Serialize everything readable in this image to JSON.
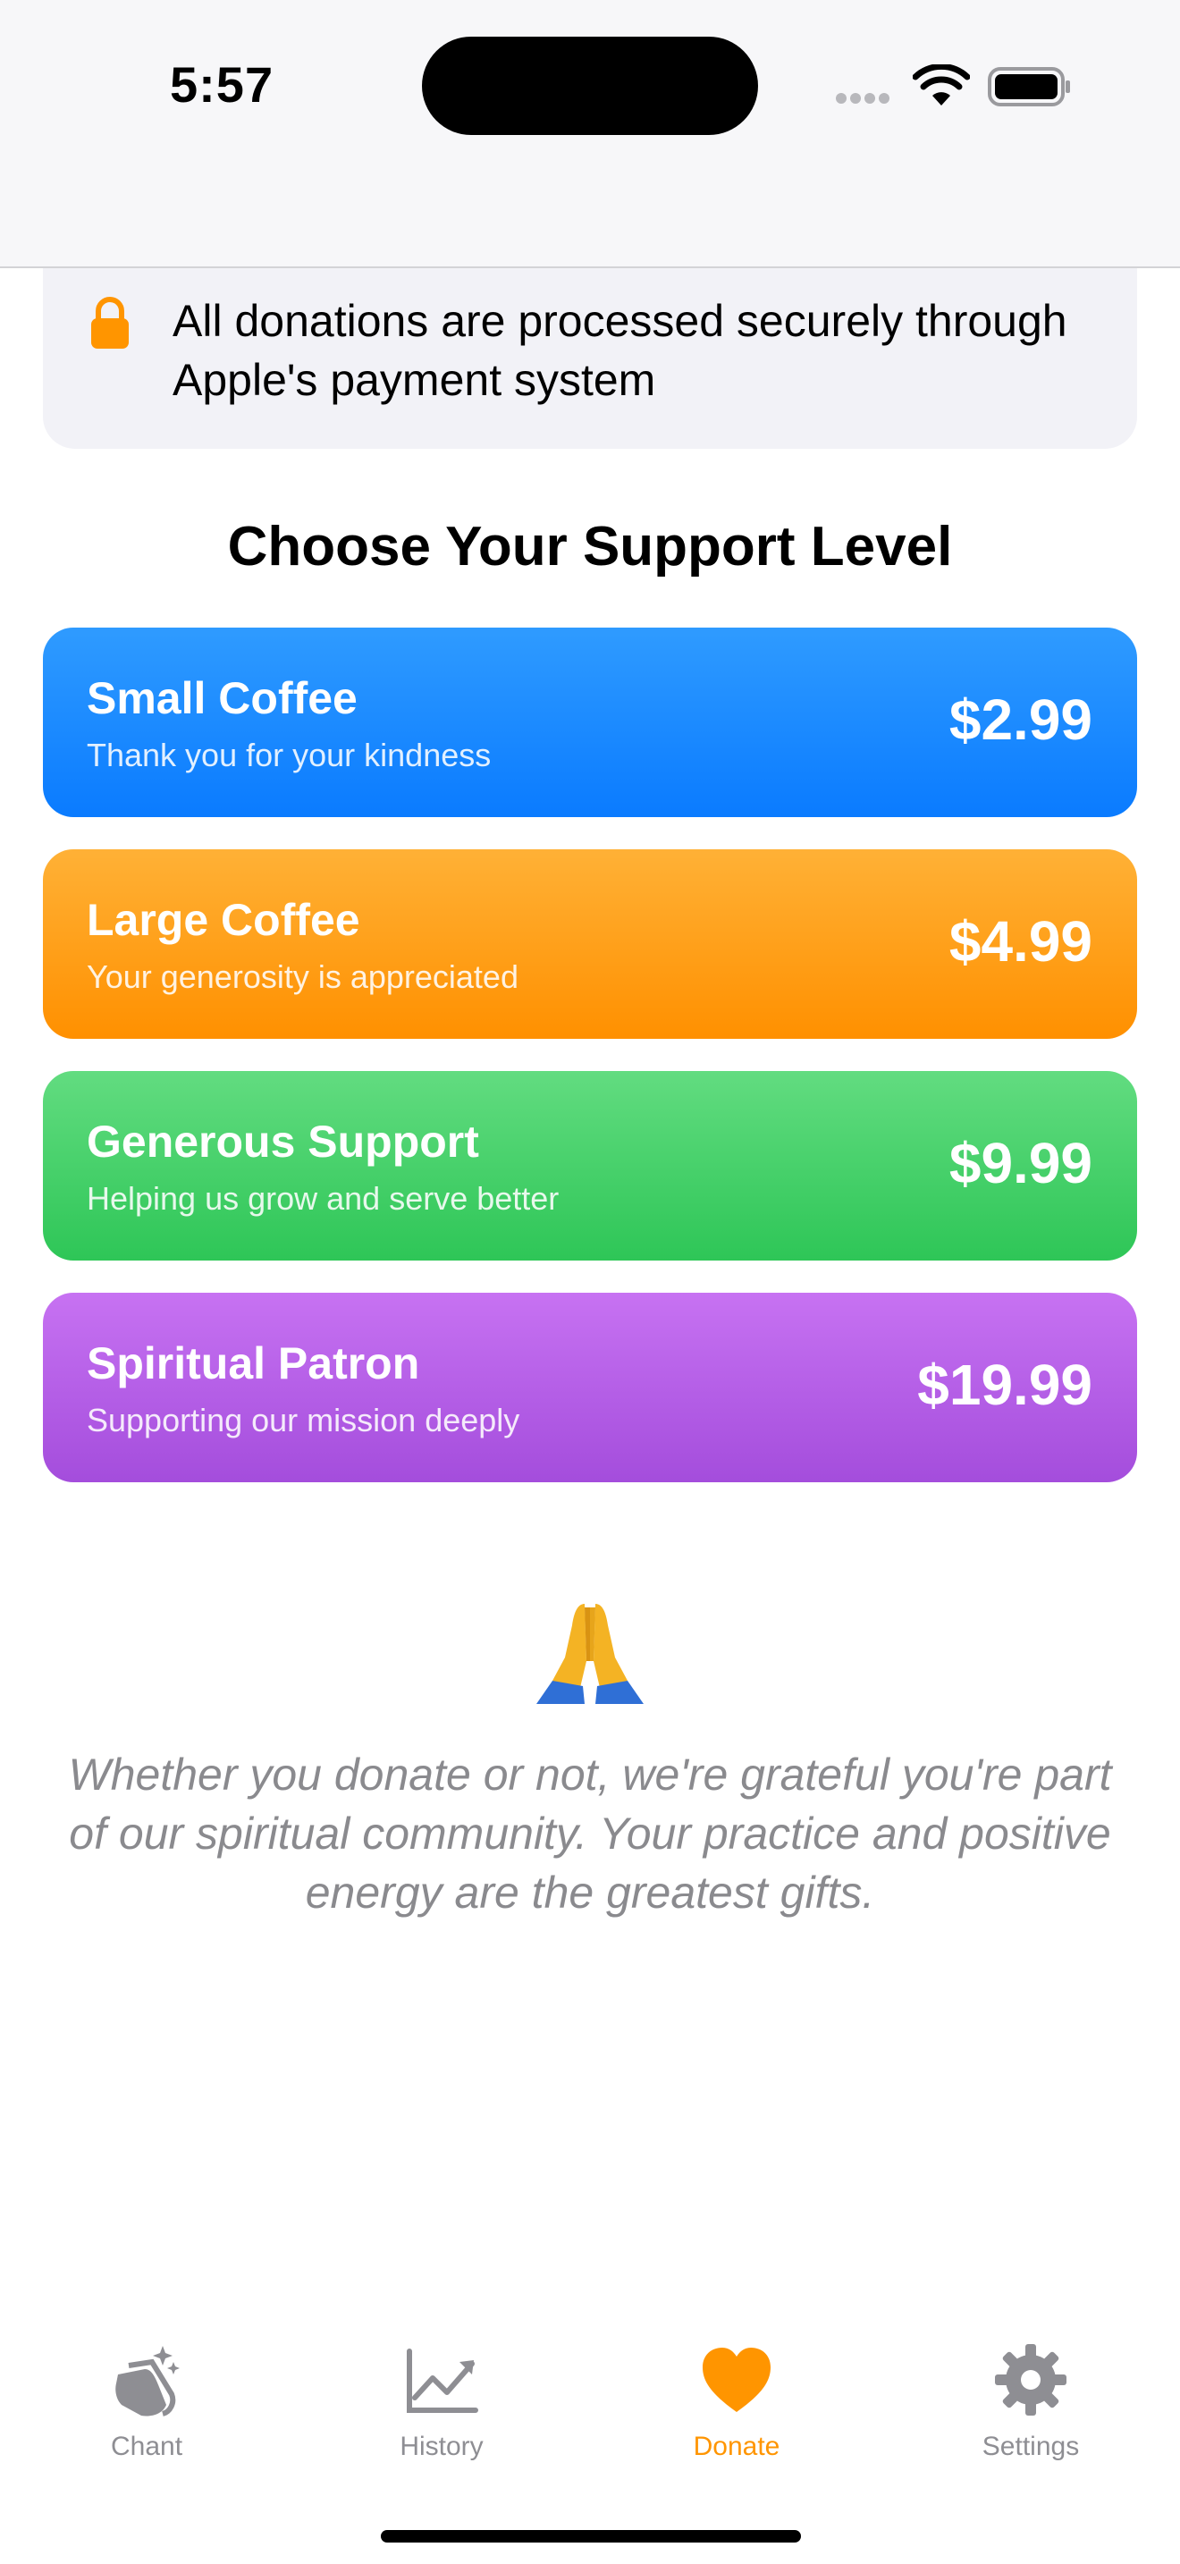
{
  "status_bar": {
    "time": "5:57"
  },
  "secure_notice": {
    "icon": "lock-icon",
    "text": "All donations are processed securely through Apple's payment system"
  },
  "support": {
    "title": "Choose Your Support Level",
    "tiers": [
      {
        "name": "Small Coffee",
        "description": "Thank you for your kindness",
        "price": "$2.99",
        "color": "#0a7bff"
      },
      {
        "name": "Large Coffee",
        "description": "Your generosity is appreciated",
        "price": "$4.99",
        "color": "#ff9500"
      },
      {
        "name": "Generous Support",
        "description": "Helping us grow and serve better",
        "price": "$9.99",
        "color": "#34c759"
      },
      {
        "name": "Spiritual Patron",
        "description": "Supporting our mission deeply",
        "price": "$19.99",
        "color": "#af52de"
      }
    ]
  },
  "gratitude": {
    "icon": "folded-hands-icon",
    "text": "Whether you donate or not, we're grateful you're part of our spiritual community. Your practice and positive energy are the greatest gifts."
  },
  "tab_bar": {
    "tabs": [
      {
        "label": "Chant",
        "icon": "clapping-hands-icon"
      },
      {
        "label": "History",
        "icon": "chart-icon"
      },
      {
        "label": "Donate",
        "icon": "heart-icon",
        "active": true
      },
      {
        "label": "Settings",
        "icon": "gear-icon"
      }
    ],
    "active_color": "#ff9500",
    "inactive_color": "#8e8e93"
  }
}
